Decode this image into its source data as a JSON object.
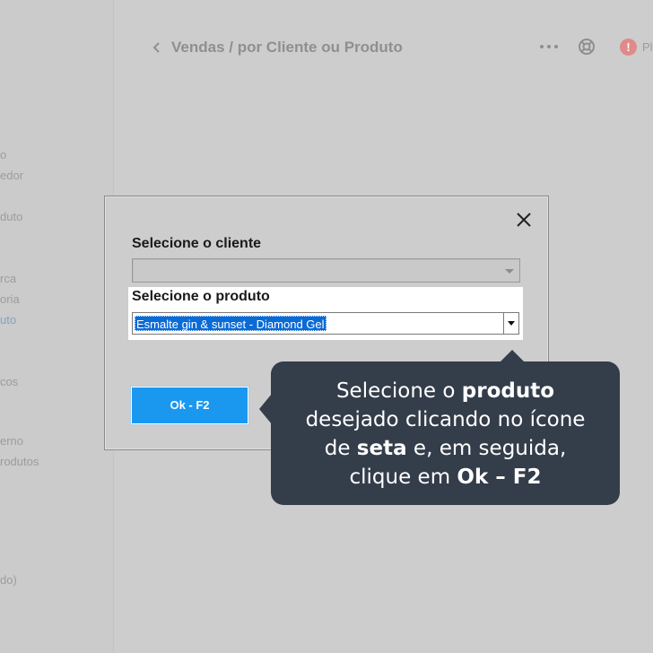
{
  "header": {
    "breadcrumb": "Vendas / por Cliente ou Produto",
    "alert_label": "Pl"
  },
  "sidebar": {
    "items": [
      {
        "label": "o"
      },
      {
        "label": "edor"
      },
      {
        "label": "duto"
      },
      {
        "label": "rca"
      },
      {
        "label": "oria"
      },
      {
        "label": "uto"
      },
      {
        "label": "cos"
      },
      {
        "label": "erno"
      },
      {
        "label": "rodutos"
      },
      {
        "label": "do)"
      }
    ]
  },
  "dialog": {
    "cliente_label": "Selecione o cliente",
    "cliente_value": "",
    "produto_label": "Selecione o produto",
    "produto_value": "Esmalte gin & sunset - Diamond Gel",
    "ok_label": "Ok - F2"
  },
  "tooltip": {
    "l1a": "Selecione o ",
    "l1b": "produto",
    "l2": "desejado clicando no ícone",
    "l3a": "de ",
    "l3b": "seta",
    "l3c": " e, em seguida,",
    "l4a": "clique em ",
    "l4b": "Ok – F2"
  },
  "colors": {
    "accent": "#1a98f0",
    "tooltip_bg": "#343d4a",
    "selection": "#0a6ad6"
  }
}
